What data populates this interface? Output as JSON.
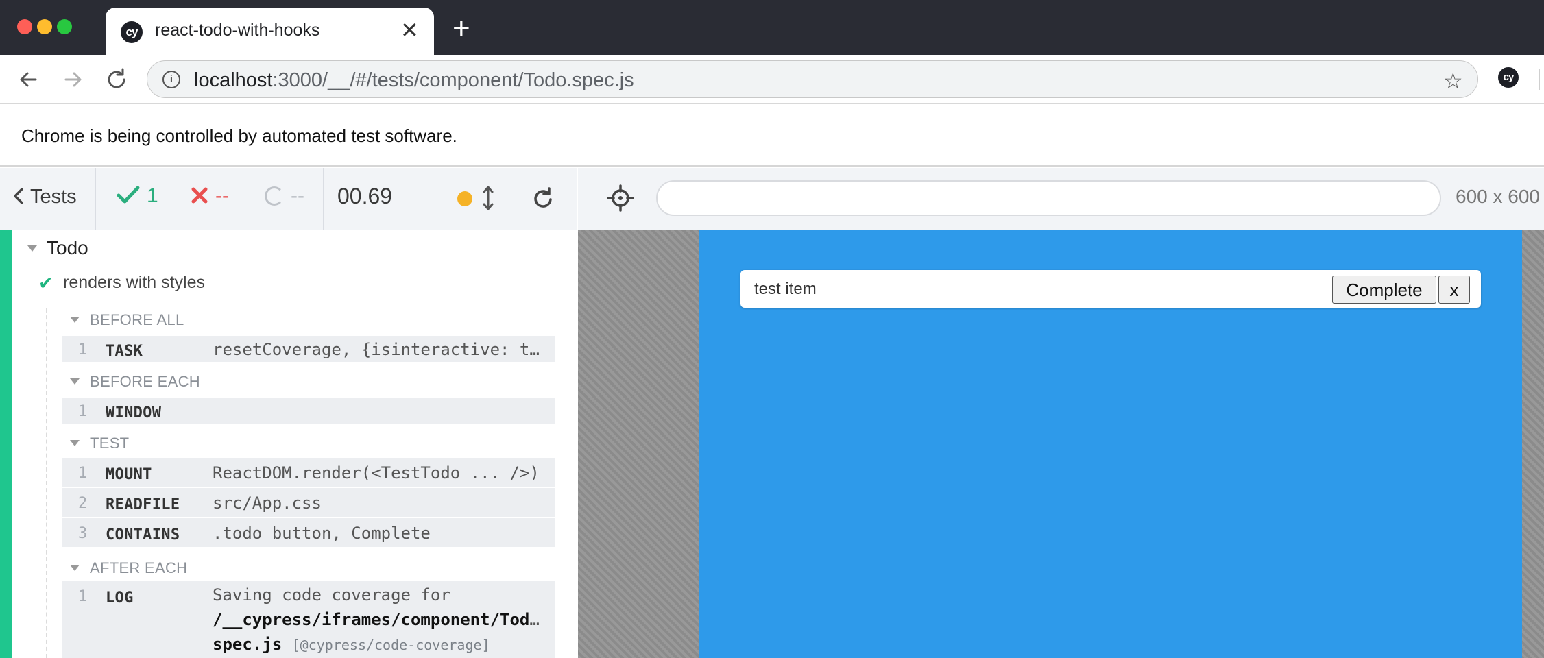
{
  "browser": {
    "tab_title": "react-todo-with-hooks",
    "tab_favicon": "cy",
    "new_tab_glyph": "+",
    "close_glyph": "✕",
    "url_host": "localhost",
    "url_rest": ":3000/__/#/tests/component/Todo.spec.js",
    "profile": "cy",
    "infobar_message": "Chrome is being controlled by automated test software.",
    "icons": [
      "back-icon",
      "forward-icon",
      "reload-icon",
      "info-icon",
      "star-icon"
    ]
  },
  "reporter": {
    "tests_label": "Tests",
    "passed": "1",
    "failed": "--",
    "pending": "--",
    "duration": "00.69",
    "status_color": "#f5b227",
    "accent_color": "#1fc68e",
    "suite": "Todo",
    "test": "renders with styles",
    "hooks": [
      {
        "label": "BEFORE ALL",
        "commands": [
          {
            "num": "1",
            "name": "TASK",
            "message": "resetCoverage, {isinteractive: true}"
          }
        ]
      },
      {
        "label": "BEFORE EACH",
        "commands": [
          {
            "num": "1",
            "name": "WINDOW",
            "message": ""
          }
        ]
      },
      {
        "label": "TEST",
        "commands": [
          {
            "num": "1",
            "name": "MOUNT",
            "message": "ReactDOM.render(<TestTodo ... />)"
          },
          {
            "num": "2",
            "name": "READFILE",
            "message": "src/App.css"
          },
          {
            "num": "3",
            "name": "CONTAINS",
            "message": ".todo button, Complete"
          }
        ]
      },
      {
        "label": "AFTER EACH",
        "commands": [
          {
            "num": "1",
            "name": "LOG",
            "message_prefix": "Saving code coverage for",
            "message_path_1": "/__cypress/iframes/component/Todo.",
            "message_path_2": "spec.js",
            "message_tag": "[@cypress/code-coverage]"
          }
        ]
      }
    ]
  },
  "aut": {
    "url_value": "",
    "viewport": "600 x 600",
    "frame_color": "#2e9aea",
    "todo": {
      "text": "test item",
      "complete_label": "Complete",
      "delete_label": "x"
    }
  }
}
